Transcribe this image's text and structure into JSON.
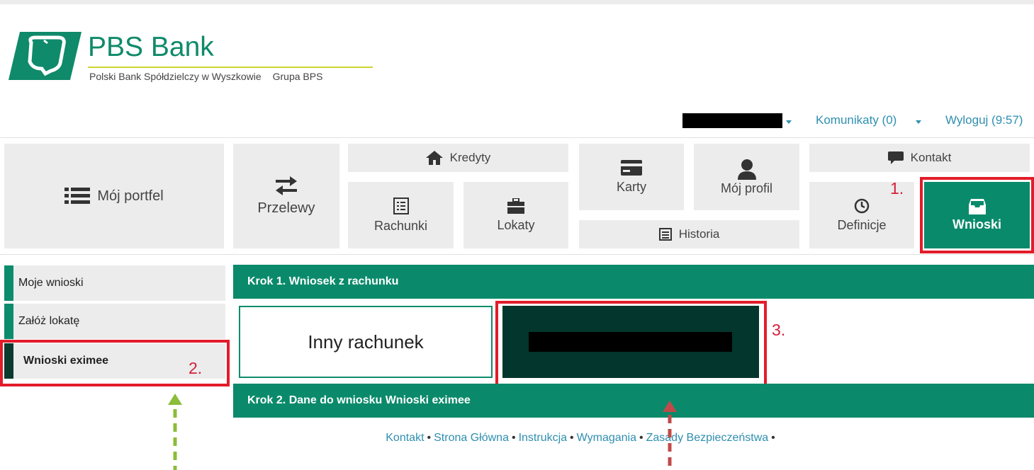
{
  "brand": {
    "name": "PBS Bank",
    "subtitle_left": "Polski Bank Spółdzielczy w Wyszkowie",
    "subtitle_right": "Grupa BPS",
    "color": "#0f8a6a"
  },
  "topbar": {
    "messages_label": "Komunikaty (0)",
    "logout_label": "Wyloguj (9:57)"
  },
  "nav": {
    "portfolio": "Mój portfel",
    "transfers": "Przelewy",
    "credits": "Kredyty",
    "accounts": "Rachunki",
    "deposits": "Lokaty",
    "cards": "Karty",
    "history": "Historia",
    "profile": "Mój profil",
    "contact": "Kontakt",
    "definitions": "Definicje",
    "applications": "Wnioski"
  },
  "sidebar": {
    "items": [
      {
        "label": "Moje wnioski",
        "active": false
      },
      {
        "label": "Załóż lokatę",
        "active": false
      },
      {
        "label": "Wnioski eximee",
        "active": true
      }
    ]
  },
  "steps": {
    "step1_title": "Krok 1. Wniosek z rachunku",
    "step2_title": "Krok 2. Dane do wniosku Wnioski eximee",
    "other_account": "Inny rachunek"
  },
  "annotations": {
    "n1": "1.",
    "n2": "2.",
    "n3": "3.",
    "arrow_green_color": "#8bbd3a",
    "arrow_red_color": "#c04a4a",
    "highlight_color": "#e21c2a"
  },
  "footer": {
    "links": [
      "Kontakt",
      "Strona Główna",
      "Instrukcja",
      "Wymagania",
      "Zasady Bezpieczeństwa"
    ],
    "separator": "•"
  },
  "colors": {
    "accent": "#0a8a6b",
    "tile_bg": "#ececec",
    "link": "#2f8fb0"
  }
}
